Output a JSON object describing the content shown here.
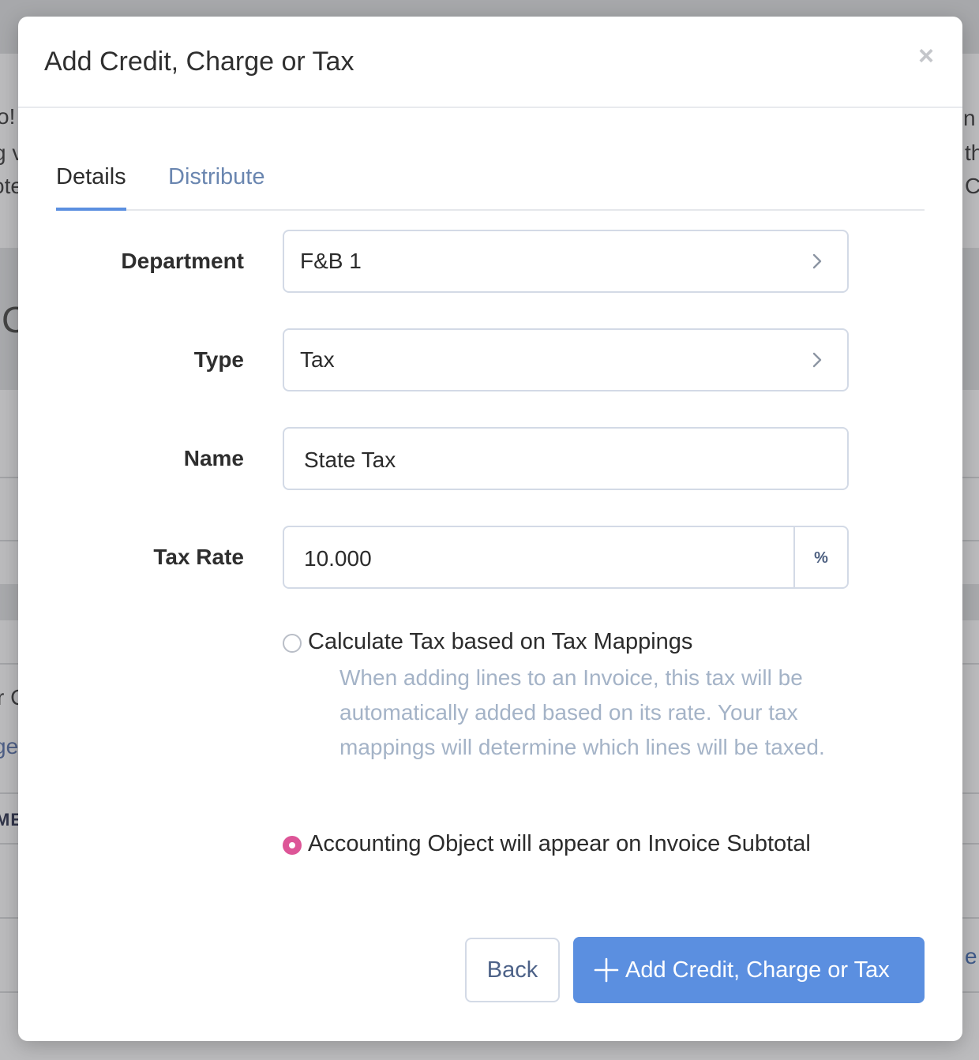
{
  "modal": {
    "title": "Add Credit, Charge or Tax",
    "close_glyph": "×"
  },
  "tabs": [
    {
      "label": "Details",
      "active": true
    },
    {
      "label": "Distribute",
      "active": false
    }
  ],
  "form": {
    "department": {
      "label": "Department",
      "value": "F&B 1",
      "icon": "chevron-right-icon"
    },
    "type": {
      "label": "Type",
      "value": "Tax",
      "icon": "chevron-right-icon"
    },
    "name": {
      "label": "Name",
      "value": "State Tax"
    },
    "tax_rate": {
      "label": "Tax Rate",
      "value": "10.000",
      "unit": "%"
    }
  },
  "options": [
    {
      "label": "Calculate Tax based on Tax Mappings",
      "help": "When adding lines to an Invoice, this tax will be automatically added based on its rate. Your tax mappings will determine which lines will be taxed.",
      "selected": false
    },
    {
      "label": "Accounting Object will appear on Invoice Subtotal",
      "help": "",
      "selected": true
    }
  ],
  "footer": {
    "back_label": "Back",
    "primary_label": "Add Credit, Charge or Tax",
    "primary_icon": "plus-icon"
  },
  "background_fragments": [
    "o!",
    "g v",
    "ote",
    "C",
    "r C",
    "ge",
    "ME",
    "n",
    "th",
    "C",
    "e"
  ],
  "colors": {
    "accent": "#5b8fe0",
    "radio_selected": "#dd5597",
    "help_text": "#a4b3c7",
    "tab_inactive": "#6a86b0"
  }
}
